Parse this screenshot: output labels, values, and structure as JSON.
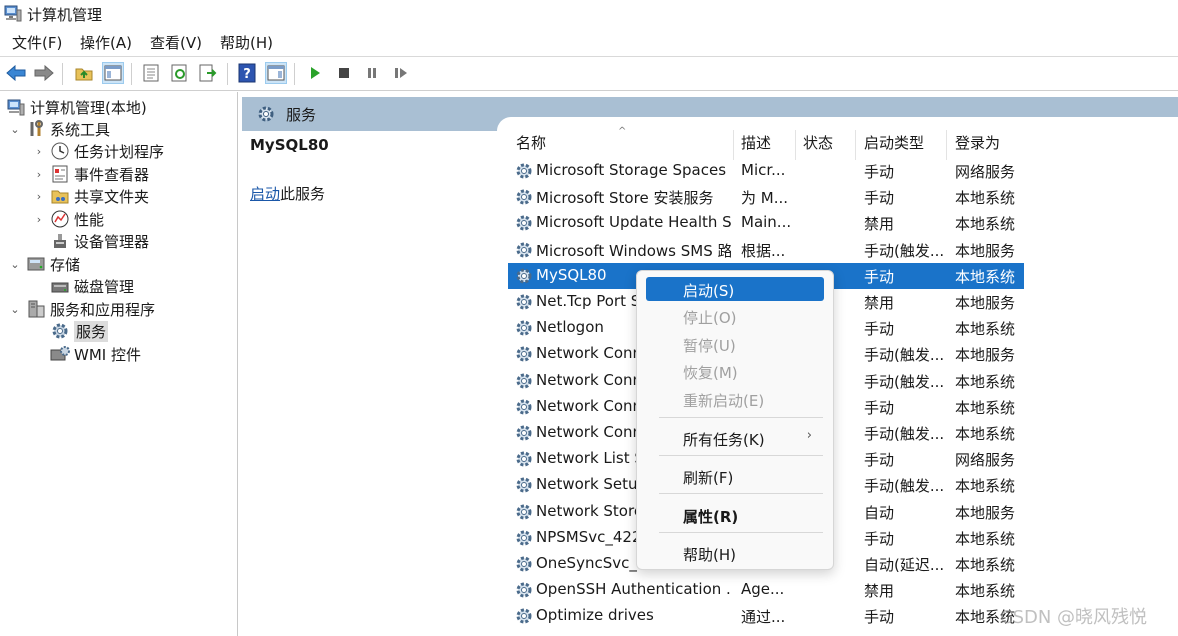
{
  "window": {
    "title": "计算机管理",
    "app_icon": "computer-management-icon"
  },
  "menu": [
    "文件(F)",
    "操作(A)",
    "查看(V)",
    "帮助(H)"
  ],
  "toolbar": {
    "icons": [
      "back-arrow-icon",
      "forward-arrow-icon",
      "up-folder-icon",
      "show-hide-console-tree-icon",
      "properties-icon",
      "refresh-icon",
      "export-list-icon",
      "help-icon",
      "show-hide-action-pane-icon",
      "play-icon",
      "stop-icon",
      "pause-icon",
      "restart-icon"
    ],
    "colors": {
      "play": "#2aa22a",
      "stop": "#444444",
      "help": "#2d55b0"
    }
  },
  "tree": {
    "root": "计算机管理(本地)",
    "nodes": [
      {
        "label": "系统工具",
        "icon": "tools-icon"
      },
      {
        "label": "任务计划程序",
        "icon": "task-scheduler-icon"
      },
      {
        "label": "事件查看器",
        "icon": "event-viewer-icon"
      },
      {
        "label": "共享文件夹",
        "icon": "shared-folders-icon"
      },
      {
        "label": "性能",
        "icon": "performance-icon"
      },
      {
        "label": "设备管理器",
        "icon": "device-manager-icon"
      },
      {
        "label": "存储",
        "icon": "storage-icon"
      },
      {
        "label": "磁盘管理",
        "icon": "disk-management-icon"
      },
      {
        "label": "服务和应用程序",
        "icon": "services-apps-icon"
      },
      {
        "label": "服务",
        "icon": "services-gear-icon"
      },
      {
        "label": "WMI 控件",
        "icon": "wmi-control-icon"
      }
    ]
  },
  "services_pane": {
    "header": "服务",
    "selected_service": "MySQL80",
    "start_link": "启动",
    "start_suffix": "此服务",
    "columns": [
      "名称",
      "描述",
      "状态",
      "启动类型",
      "登录为"
    ],
    "rows": [
      {
        "name": "Microsoft Storage Spaces S...",
        "desc": "Micr...",
        "status": "",
        "startup": "手动",
        "logon": "网络服务"
      },
      {
        "name": "Microsoft Store 安装服务",
        "desc": "为 M...",
        "status": "",
        "startup": "手动",
        "logon": "本地系统"
      },
      {
        "name": "Microsoft Update Health S...",
        "desc": "Main...",
        "status": "",
        "startup": "禁用",
        "logon": "本地系统"
      },
      {
        "name": "Microsoft Windows SMS 路...",
        "desc": "根据...",
        "status": "",
        "startup": "手动(触发...",
        "logon": "本地服务"
      },
      {
        "name": "MySQL80",
        "desc": "",
        "status": "",
        "startup": "手动",
        "logon": "本地系统"
      },
      {
        "name": "Net.Tcp Port S",
        "desc": "",
        "status": "",
        "startup": "禁用",
        "logon": "本地服务"
      },
      {
        "name": "Netlogon",
        "desc": "",
        "status": "",
        "startup": "手动",
        "logon": "本地系统"
      },
      {
        "name": "Network Conn",
        "desc": "",
        "status": "",
        "startup": "手动(触发...",
        "logon": "本地服务"
      },
      {
        "name": "Network Conn",
        "desc": "",
        "status": "...",
        "startup": "手动(触发...",
        "logon": "本地系统"
      },
      {
        "name": "Network Conn",
        "desc": "",
        "status": "",
        "startup": "手动",
        "logon": "本地系统"
      },
      {
        "name": "Network Conn",
        "desc": "",
        "status": "",
        "startup": "手动(触发...",
        "logon": "本地系统"
      },
      {
        "name": "Network List S",
        "desc": "",
        "status": "",
        "startup": "手动",
        "logon": "网络服务"
      },
      {
        "name": "Network Setup",
        "desc": "",
        "status": "",
        "startup": "手动(触发...",
        "logon": "本地系统"
      },
      {
        "name": "Network Store",
        "desc": "",
        "status": "",
        "startup": "自动",
        "logon": "本地服务"
      },
      {
        "name": "NPSMSvc_422",
        "desc": "",
        "status": "",
        "startup": "手动",
        "logon": "本地系统"
      },
      {
        "name": "OneSyncSvc_42",
        "desc": "",
        "status": "",
        "startup": "自动(延迟...",
        "logon": "本地系统"
      },
      {
        "name": "OpenSSH Authentication ...",
        "desc": "Age...",
        "status": "",
        "startup": "禁用",
        "logon": "本地系统"
      },
      {
        "name": "Optimize drives",
        "desc": "通过...",
        "status": "",
        "startup": "手动",
        "logon": "本地系统"
      }
    ]
  },
  "context_menu": {
    "items": [
      {
        "label": "启动(S)",
        "state": "highlighted"
      },
      {
        "label": "停止(O)",
        "state": "disabled"
      },
      {
        "label": "暂停(U)",
        "state": "disabled"
      },
      {
        "label": "恢复(M)",
        "state": "disabled"
      },
      {
        "label": "重新启动(E)",
        "state": "disabled"
      },
      {
        "label": "所有任务(K)",
        "state": "submenu"
      },
      {
        "label": "刷新(F)",
        "state": "normal"
      },
      {
        "label": "属性(R)",
        "state": "bold"
      },
      {
        "label": "帮助(H)",
        "state": "normal"
      }
    ],
    "submenu_arrow": "›"
  },
  "watermark": "CSDN @晓风残悦"
}
